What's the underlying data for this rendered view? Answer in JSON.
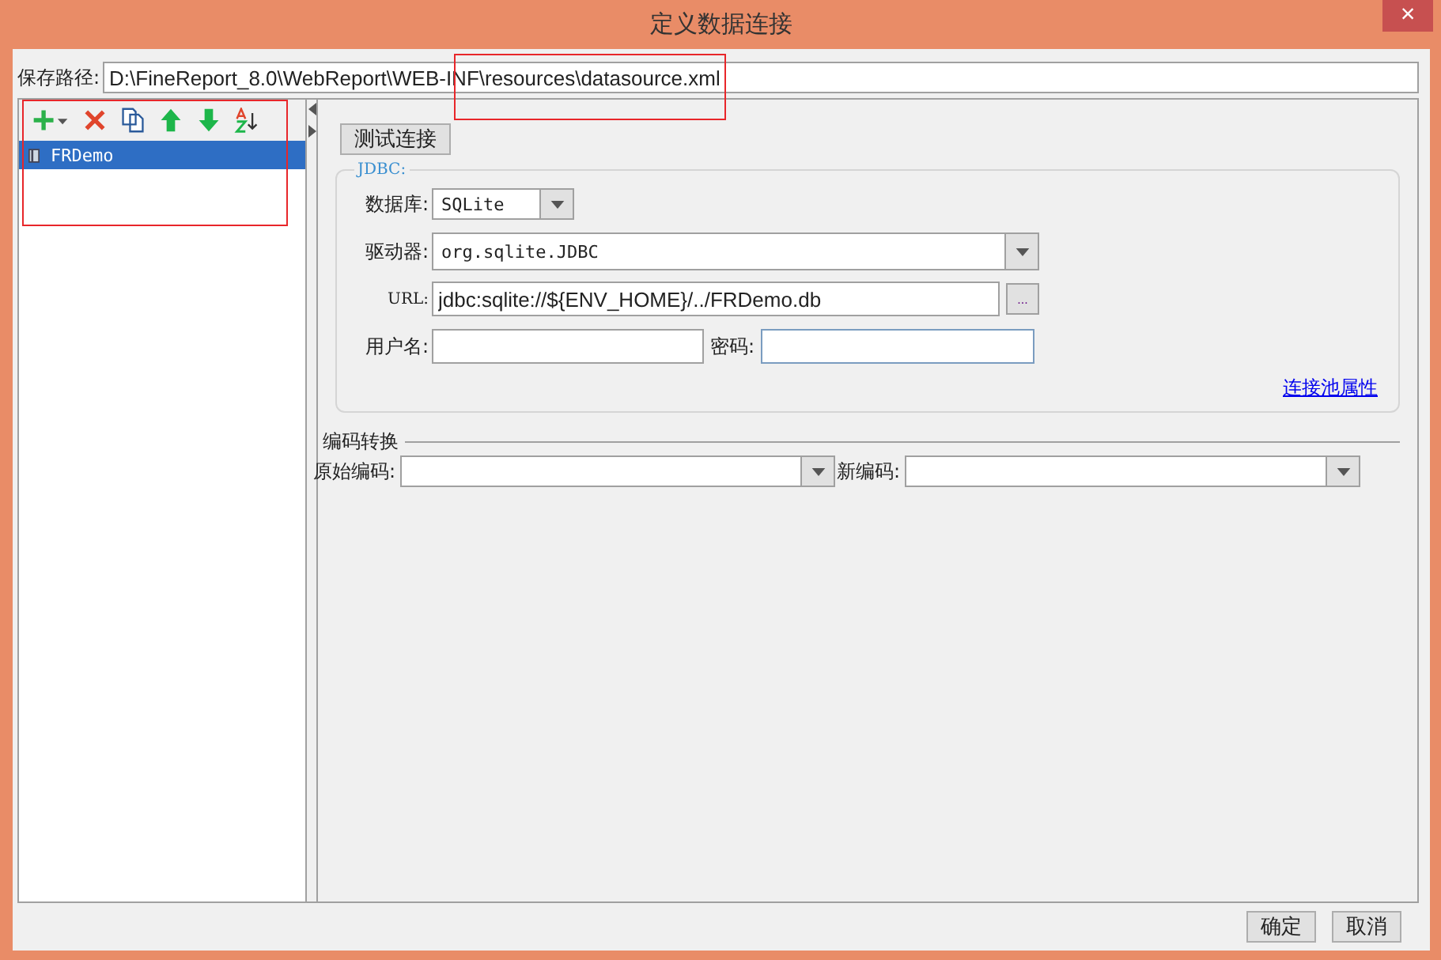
{
  "window": {
    "title": "定义数据连接",
    "close": "×"
  },
  "save_path": {
    "label": "保存路径:",
    "value": "D:\\FineReport_8.0\\WebReport\\WEB-INF\\resources\\datasource.xml"
  },
  "connections": [
    {
      "name": "FRDemo",
      "selected": true
    }
  ],
  "test_button": "测试连接",
  "jdbc": {
    "legend": "JDBC:",
    "database": {
      "label": "数据库:",
      "value": "SQLite"
    },
    "driver": {
      "label": "驱动器:",
      "value": "org.sqlite.JDBC"
    },
    "url": {
      "label": "URL:",
      "value": "jdbc:sqlite://${ENV_HOME}/../FRDemo.db",
      "browse": "..."
    },
    "username": {
      "label": "用户名:"
    },
    "password": {
      "label": "密码:"
    },
    "pool_link": "连接池属性"
  },
  "encoding": {
    "legend": "编码转换",
    "original": {
      "label": "原始编码:"
    },
    "new": {
      "label": "新编码:"
    }
  },
  "buttons": [
    "确定",
    "取消"
  ]
}
